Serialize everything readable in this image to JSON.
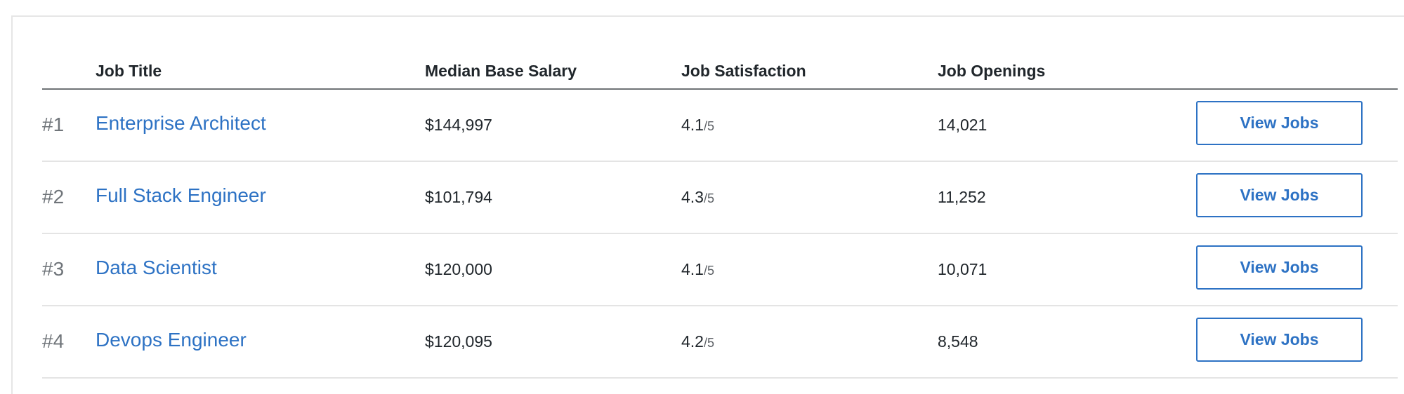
{
  "table": {
    "headers": {
      "job_title": "Job Title",
      "salary": "Median Base Salary",
      "satisfaction": "Job Satisfaction",
      "openings": "Job Openings"
    },
    "rows": [
      {
        "rank": "#1",
        "title": "Enterprise Architect",
        "salary": "$144,997",
        "satisfaction": "4.1",
        "satisfaction_scale": "/5",
        "openings": "14,021",
        "button": "View Jobs"
      },
      {
        "rank": "#2",
        "title": "Full Stack Engineer",
        "salary": "$101,794",
        "satisfaction": "4.3",
        "satisfaction_scale": "/5",
        "openings": "11,252",
        "button": "View Jobs"
      },
      {
        "rank": "#3",
        "title": "Data Scientist",
        "salary": "$120,000",
        "satisfaction": "4.1",
        "satisfaction_scale": "/5",
        "openings": "10,071",
        "button": "View Jobs"
      },
      {
        "rank": "#4",
        "title": "Devops Engineer",
        "salary": "$120,095",
        "satisfaction": "4.2",
        "satisfaction_scale": "/5",
        "openings": "8,548",
        "button": "View Jobs"
      }
    ]
  },
  "colors": {
    "link": "#2d72c4",
    "text": "#20262b",
    "muted": "#70757a",
    "border": "#e4e4e4",
    "header_rule": "#6f7376"
  }
}
